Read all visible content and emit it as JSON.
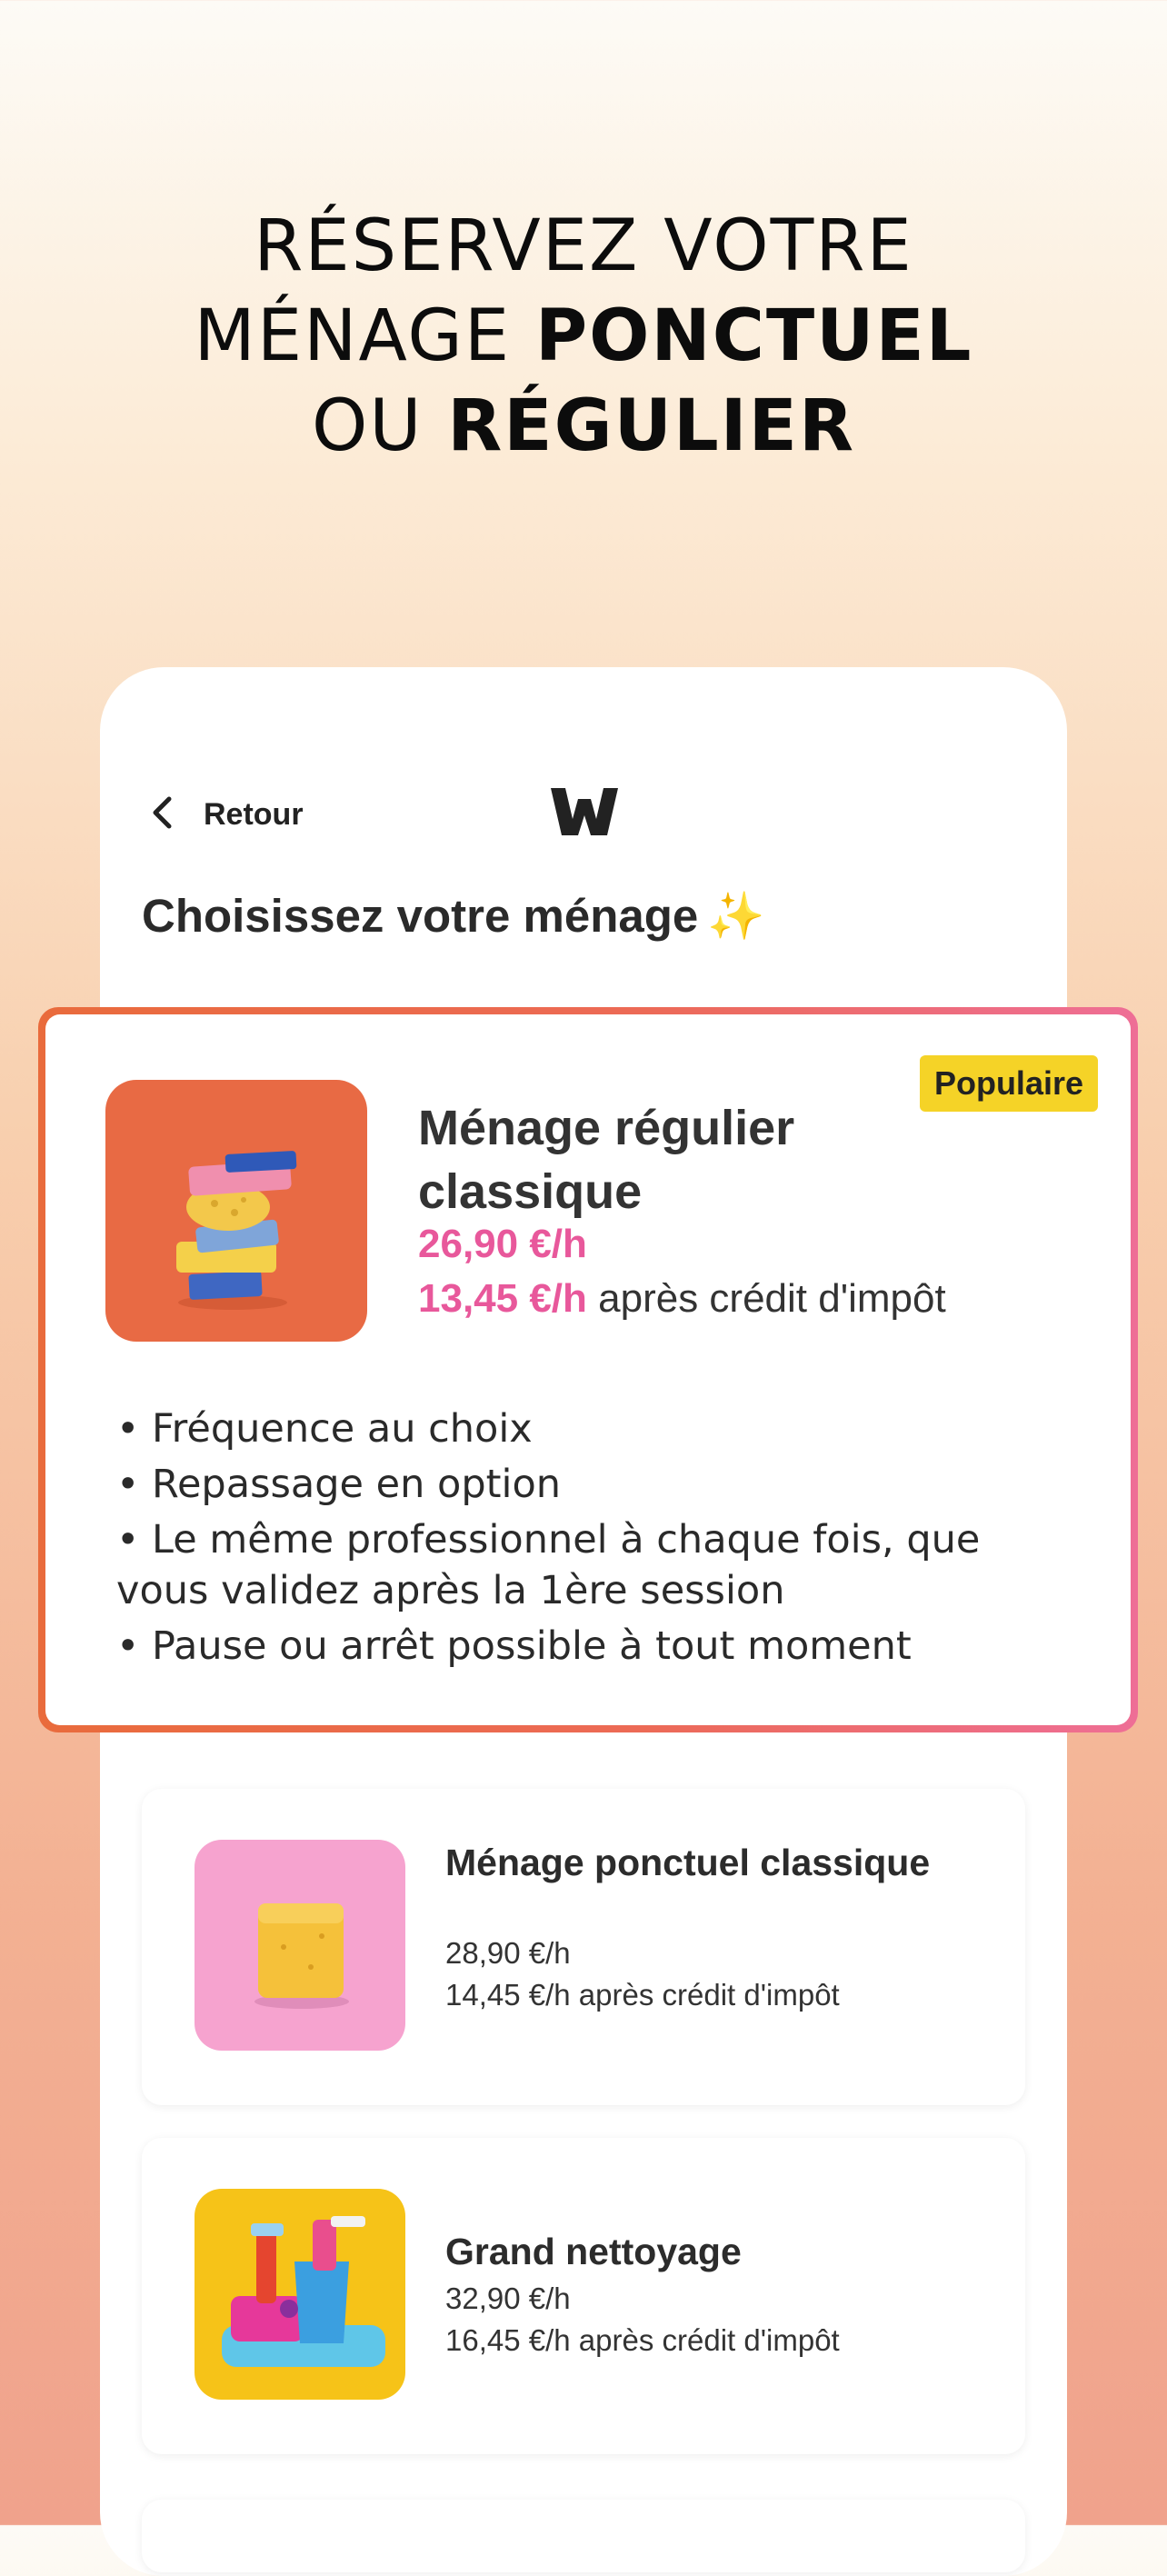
{
  "headline": {
    "line1": "RÉSERVEZ VOTRE",
    "line2_light": "MÉNAGE ",
    "line2_bold": "PONCTUEL",
    "line3_light": "OU ",
    "line3_bold": "RÉGULIER"
  },
  "app": {
    "back_label": "Retour",
    "logo_icon": "w-logo-icon",
    "page_title": "Choisissez votre ménage",
    "title_emoji": "✨"
  },
  "featured": {
    "badge": "Populaire",
    "title": "Ménage régulier classique",
    "price": "26,90 €/h",
    "credit_price": "13,45 €/h",
    "credit_suffix": " après crédit d'impôt",
    "features": [
      "• Fréquence au choix",
      "• Repassage en option",
      "• Le même professionnel à chaque fois, que vous validez après la 1ère session",
      "• Pause ou arrêt possible à tout moment"
    ]
  },
  "services": [
    {
      "title": "Ménage ponctuel classique",
      "price": "28,90 €/h",
      "credit_line": "14,45 €/h après crédit d'impôt"
    },
    {
      "title": "Grand nettoyage",
      "price": "32,90 €/h",
      "credit_line": "16,45 €/h après crédit d'impôt"
    }
  ],
  "colors": {
    "accent_pink": "#e8589b",
    "badge_yellow": "#f5d327",
    "border_orange": "#e96b3c"
  }
}
